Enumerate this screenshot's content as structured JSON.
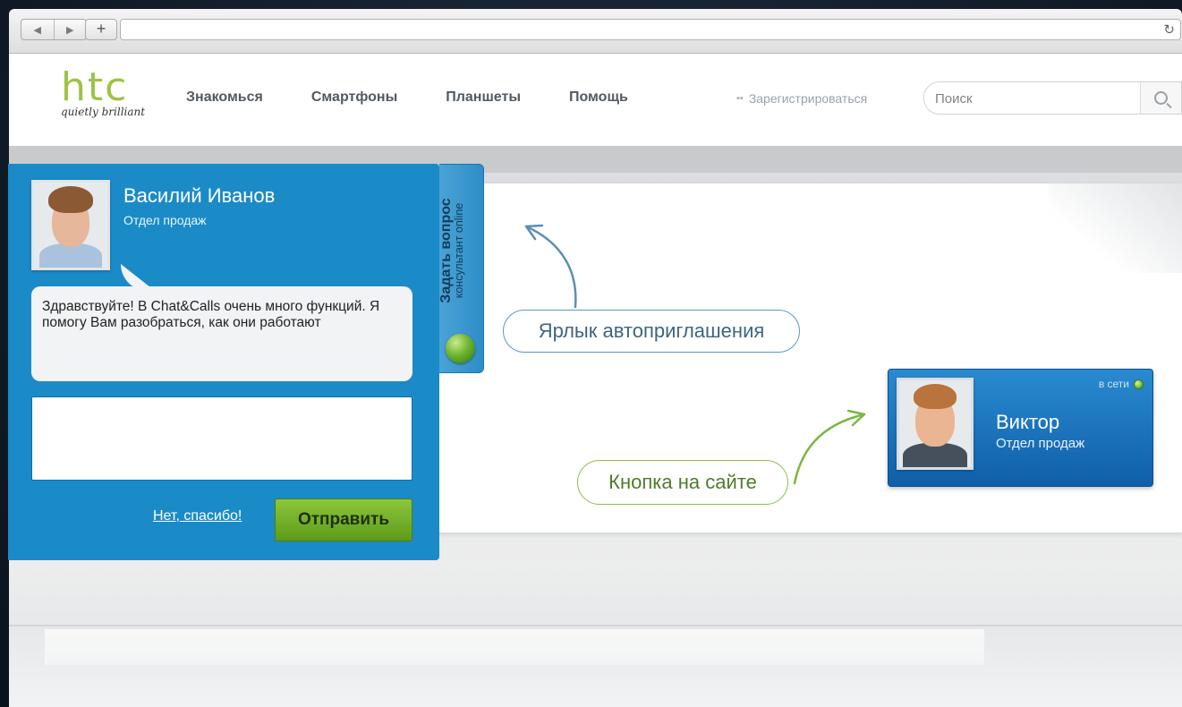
{
  "browser": {
    "back_icon": "◀",
    "forward_icon": "▶",
    "new_tab_icon": "+",
    "reload_icon": "↻"
  },
  "header": {
    "logo": "htc",
    "tagline": "quietly brilliant",
    "nav": [
      "Знакомься",
      "Смартфоны",
      "Планшеты",
      "Помощь"
    ],
    "register_label": "Зарегистрироваться",
    "search_placeholder": "Поиск"
  },
  "chat": {
    "agent_name": "Василий Иванов",
    "agent_dept": "Отдел продаж",
    "message": "Здравствуйте! В Chat&Calls очень много функций. Я помогу Вам разобраться, как они работают",
    "input_value": "",
    "decline_label": "Нет, спасибо!",
    "send_label": "Отправить"
  },
  "tab": {
    "title": "Задать вопрос",
    "subtitle": "консультант online"
  },
  "annotations": {
    "invite_label": "Ярлык автоприглашения",
    "button_label": "Кнопка на сайте"
  },
  "operator": {
    "status": "в сети",
    "name": "Виктор",
    "dept": "Отдел продаж"
  },
  "colors": {
    "brand_green": "#9ec246",
    "chat_blue": "#1b8bc8",
    "send_green": "#6aa62a",
    "widget_blue": "#1a70b8"
  }
}
